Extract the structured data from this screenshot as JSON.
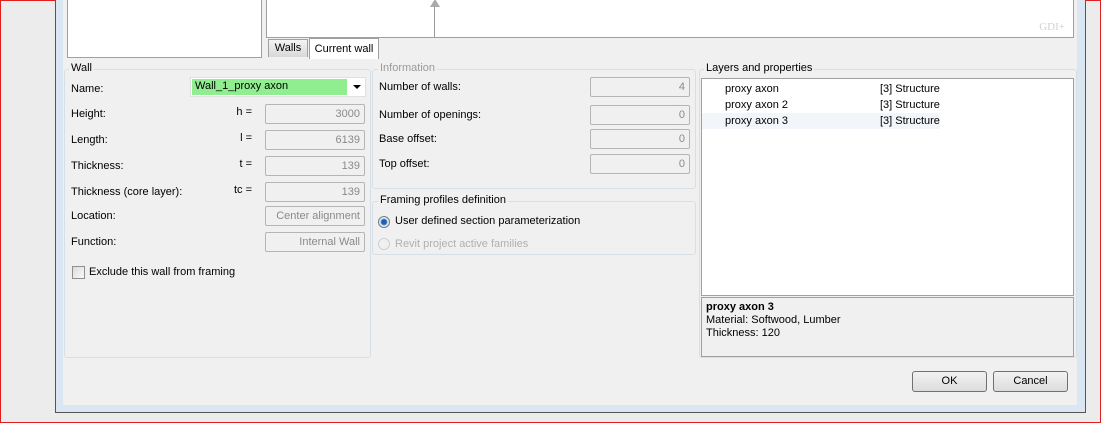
{
  "preview": {
    "renderer_label": "GDI+"
  },
  "tabs": [
    {
      "label": "Walls",
      "selected": false
    },
    {
      "label": "Current wall",
      "selected": true
    }
  ],
  "wall": {
    "title": "Wall",
    "name_label": "Name:",
    "name_value": "Wall_1_proxy axon",
    "name_color": "#90ee90",
    "fields": [
      {
        "label": "Height:",
        "symbol": "h =",
        "value": "3000"
      },
      {
        "label": "Length:",
        "symbol": "l =",
        "value": "6139"
      },
      {
        "label": "Thickness:",
        "symbol": "t =",
        "value": "139"
      },
      {
        "label": "Thickness (core layer):",
        "symbol": "tc =",
        "value": "139"
      },
      {
        "label": "Location:",
        "symbol": "",
        "value": "Center alignment"
      },
      {
        "label": "Function:",
        "symbol": "",
        "value": "Internal Wall"
      }
    ],
    "exclude_label": "Exclude this wall from framing",
    "exclude_checked": false
  },
  "information": {
    "title": "Information",
    "fields": [
      {
        "label": "Number of walls:",
        "value": "4"
      },
      {
        "label": "Number of openings:",
        "value": "0"
      },
      {
        "label": "Base offset:",
        "value": "0"
      },
      {
        "label": "Top offset:",
        "value": "0"
      }
    ]
  },
  "framing": {
    "title": "Framing profiles definition",
    "options": [
      {
        "label": "User defined section parameterization",
        "selected": true,
        "enabled": true
      },
      {
        "label": "Revit project active families",
        "selected": false,
        "enabled": false
      }
    ]
  },
  "layers": {
    "title": "Layers and properties",
    "rows": [
      {
        "name": "proxy axon",
        "function": "[3] Structure"
      },
      {
        "name": "proxy axon 2",
        "function": "[3] Structure"
      },
      {
        "name": "proxy axon 3",
        "function": "[3] Structure"
      }
    ],
    "details": {
      "title": "proxy axon 3",
      "material": "Material: Softwood, Lumber",
      "thickness": "Thickness: 120"
    }
  },
  "buttons": {
    "ok": "OK",
    "cancel": "Cancel"
  }
}
